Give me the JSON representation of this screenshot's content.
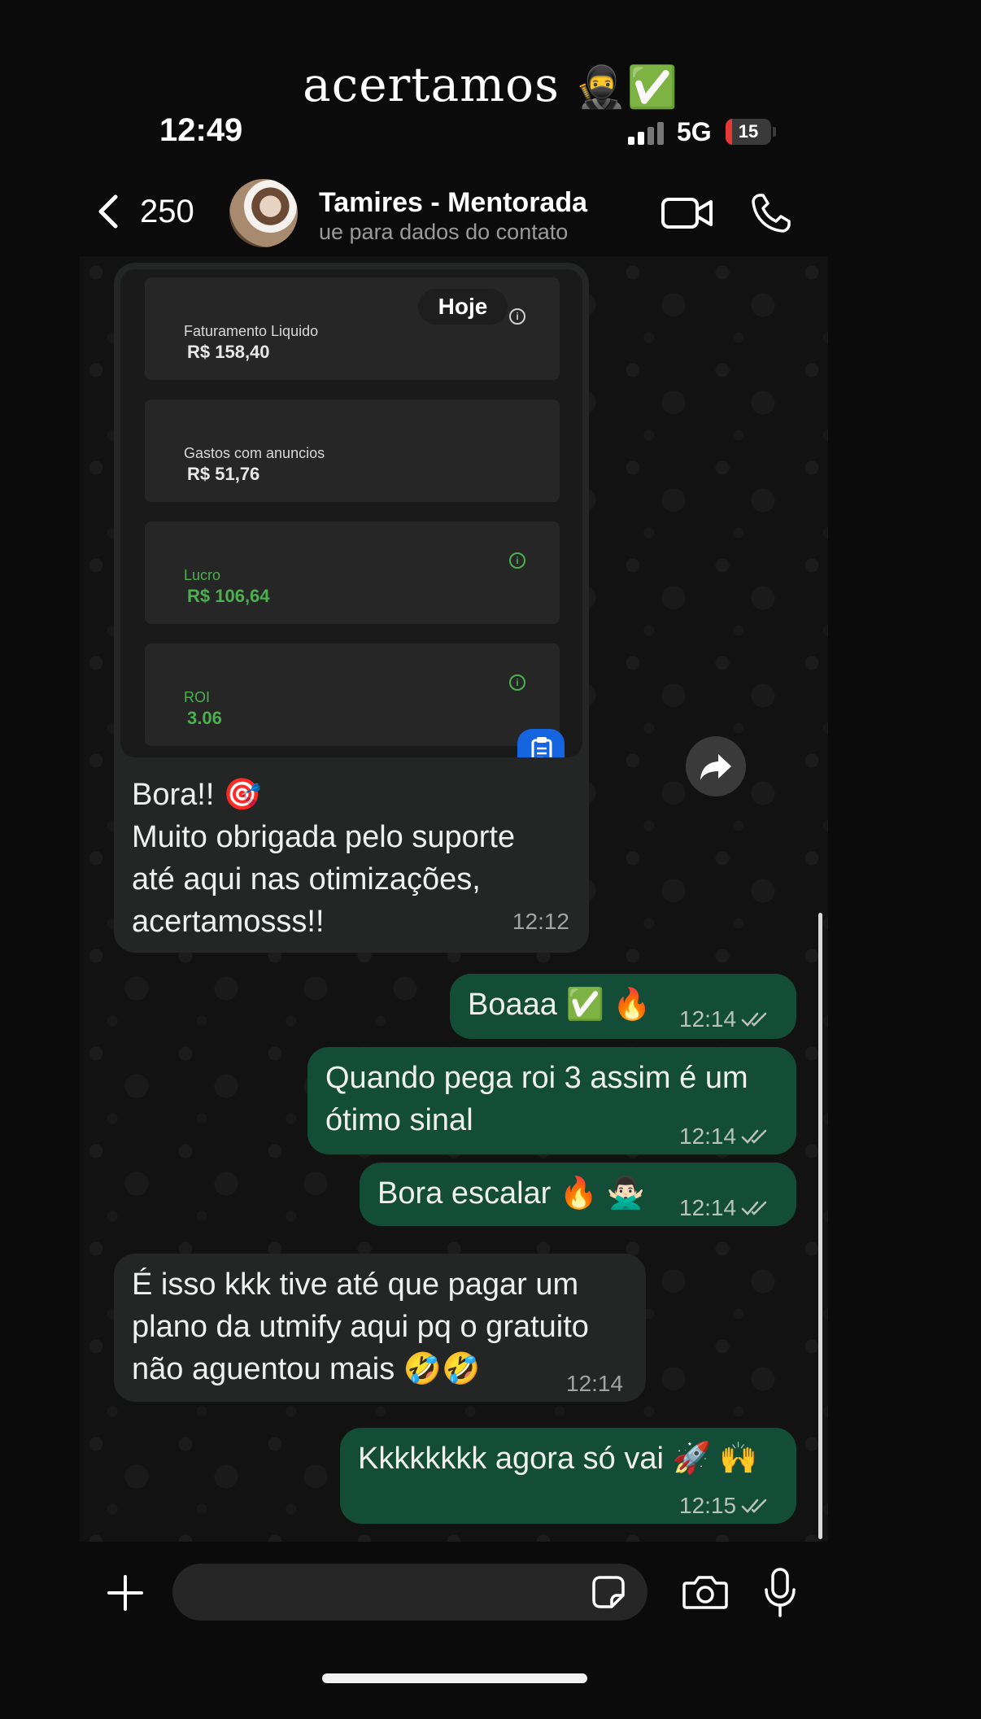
{
  "caption": {
    "text": "acertamos",
    "emoji": "🥷✅"
  },
  "status_bar": {
    "time": "12:49",
    "network": "5G",
    "battery": "15",
    "battery_level": 0.15
  },
  "header": {
    "back_count": "250",
    "contact_name": "Tamires - Mentorada",
    "contact_subtitle": "ue para dados do contato"
  },
  "image_message": {
    "date_chip": "Hoje",
    "metrics": [
      {
        "label": "Faturamento Liquido",
        "value": "R$ 158,40"
      },
      {
        "label": "Gastos com anuncios",
        "value": "R$ 51,76"
      },
      {
        "label": "Lucro",
        "value": "R$ 106,64"
      },
      {
        "label": "ROI",
        "value": "3.06"
      }
    ],
    "info_icon": "i"
  },
  "messages": [
    {
      "direction": "in",
      "lines": [
        "Bora!! 🎯",
        "Muito obrigada pelo suporte",
        "até aqui nas otimizações,",
        "acertamosss!!"
      ],
      "time": "12:12"
    },
    {
      "direction": "out",
      "lines": [
        "Boaaa ✅ 🔥"
      ],
      "time": "12:14"
    },
    {
      "direction": "out",
      "lines": [
        "Quando pega roi 3 assim é um",
        "ótimo sinal"
      ],
      "time": "12:14"
    },
    {
      "direction": "out",
      "lines": [
        "Bora escalar 🔥 🙅🏻‍♂️"
      ],
      "time": "12:14"
    },
    {
      "direction": "in",
      "lines": [
        "É isso kkk tive até que pagar um",
        "plano da utmify aqui pq o gratuito",
        "não aguentou mais 🤣🤣"
      ],
      "time": "12:14"
    },
    {
      "direction": "out",
      "lines": [
        "Kkkkkkkk agora só vai 🚀 🙌"
      ],
      "time": "12:15"
    }
  ],
  "composer": {
    "placeholder": ""
  },
  "colors": {
    "incoming": "#242626",
    "outgoing": "#144d37",
    "green_metric": "#4caf50",
    "clip_button": "#1565e0"
  },
  "icons": [
    "back-chevron-icon",
    "video-call-icon",
    "phone-icon",
    "forward-icon",
    "clipboard-icon",
    "plus-icon",
    "sticker-icon",
    "camera-icon",
    "mic-icon",
    "double-check-icon"
  ]
}
